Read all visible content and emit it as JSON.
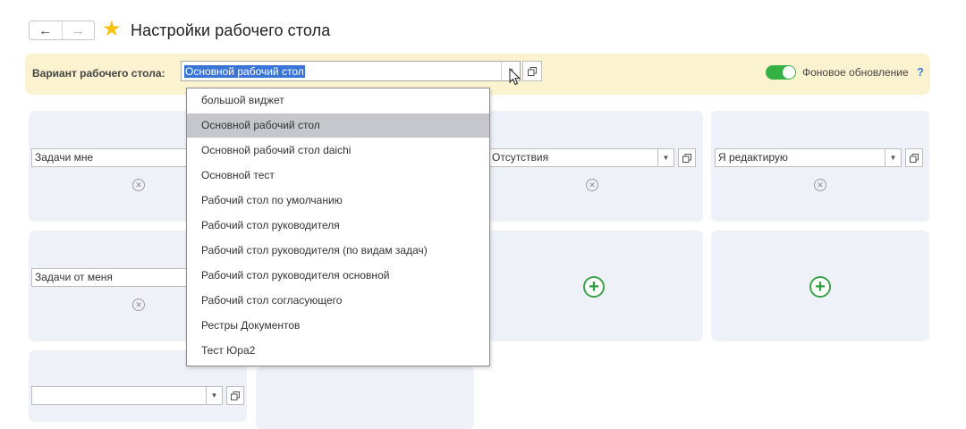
{
  "header": {
    "back_icon": "arrow-left-icon",
    "forward_icon": "arrow-right-icon",
    "favorite_icon": "star-icon",
    "title": "Настройки рабочего стола"
  },
  "variant": {
    "label": "Вариант рабочего стола:",
    "value": "Основной рабочий стол",
    "background_update_label": "Фоновое обновление",
    "background_update_on": true,
    "help": "?"
  },
  "dropdown": {
    "selected_index": 1,
    "options": [
      "большой виджет",
      "Основной рабочий стол",
      "Основной рабочий стол daichi",
      "Основной тест",
      "Рабочий стол по умолчанию",
      "Рабочий стол руководителя",
      "Рабочий стол руководителя (по видам задач)",
      "Рабочий стол руководителя основной",
      "Рабочий стол согласующего",
      "Рестры Документов",
      "Тест Юра2"
    ]
  },
  "widgets": {
    "w1": {
      "value": "Задачи мне"
    },
    "w2": {
      "value": "Отсутствия"
    },
    "w3": {
      "value": "Я редактирую"
    },
    "w4": {
      "value": "Задачи от меня"
    }
  },
  "colors": {
    "accent_blue": "#3875d7",
    "variant_bar_bg": "#fbf2cf",
    "panel_bg": "#eef2f8",
    "toggle_green": "#35b045",
    "star_yellow": "#f5c311",
    "plus_green": "#3aa24a"
  }
}
